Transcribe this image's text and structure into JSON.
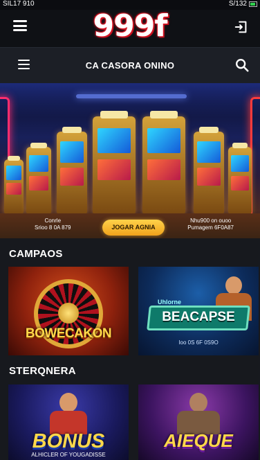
{
  "status_bar": {
    "left_text": "SIL17 910",
    "right_text": "S/132"
  },
  "header": {
    "logo_text": "999f"
  },
  "nav": {
    "title": "CA CASORA ONINO"
  },
  "hero": {
    "left_caption_line1": "Conrle",
    "left_caption_line2": "Srioo 8 0A 879",
    "button_label": "JOGAR AGNIA",
    "right_caption_line1": "Nhu900 on ouoo",
    "right_caption_line2": "Pumagem 6F0A87"
  },
  "sections": [
    {
      "title": "CAMPAOS",
      "cards": [
        {
          "label": "BOWECAKON"
        },
        {
          "tag": "Uhlorne",
          "label": "BEACAPSE",
          "sub": "Ioo 0S 6F 0S9O"
        }
      ]
    },
    {
      "title": "STERQNERA",
      "cards": [
        {
          "label": "BONUS",
          "sub": "ALHICLER OF YOUGADISSE"
        },
        {
          "label": "AIEQUE"
        }
      ]
    }
  ],
  "colors": {
    "background": "#17191e",
    "app_bar": "#0f1115",
    "nav_bar": "#1c1f26",
    "logo_glow": "#e21d2c",
    "play_button": "#f6b92c"
  }
}
